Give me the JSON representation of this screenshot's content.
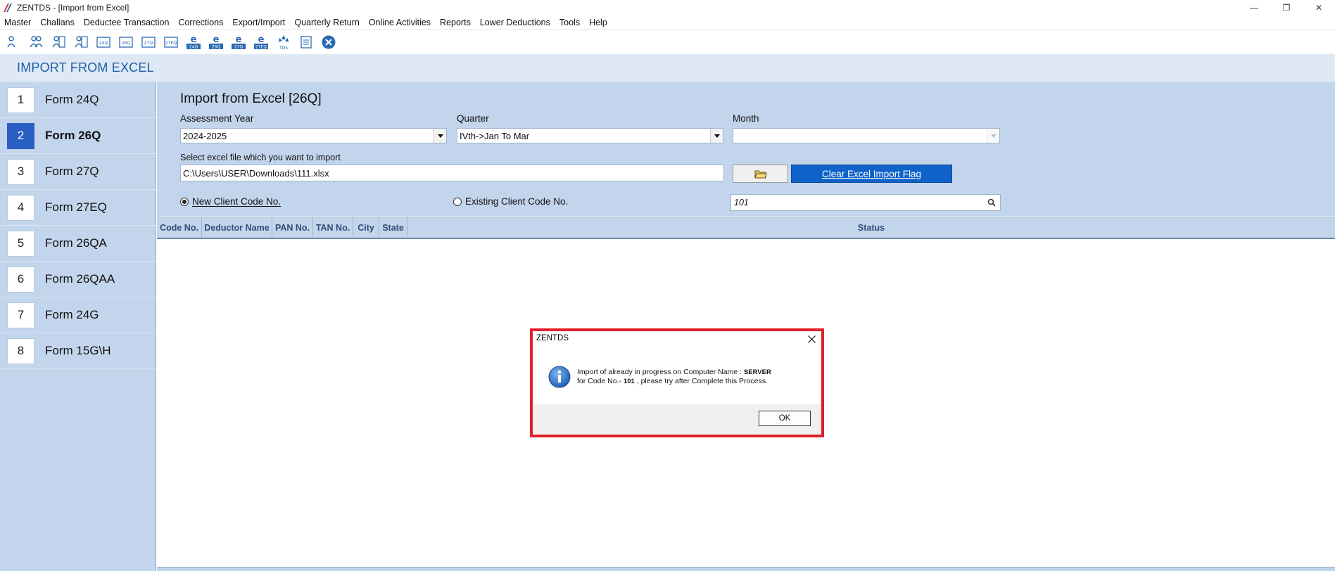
{
  "window": {
    "title": "ZENTDS - [Import from Excel]",
    "minimize_glyph": "—",
    "restore_glyph": "❐",
    "close_glyph": "✕"
  },
  "menu": [
    "Master",
    "Challans",
    "Deductee Transaction",
    "Corrections",
    "Export/Import",
    "Quarterly Return",
    "Online Activities",
    "Reports",
    "Lower Deductions",
    "Tools",
    "Help"
  ],
  "toolbar": {
    "icons": [
      {
        "name": "users-icon"
      },
      {
        "name": "group-icon"
      },
      {
        "name": "person-doc-icon"
      },
      {
        "name": "person-doc2-icon"
      },
      {
        "name": "form-24q-doc-icon",
        "label": "24Q"
      },
      {
        "name": "form-26q-doc-icon",
        "label": "26Q"
      },
      {
        "name": "form-27q-doc-icon",
        "label": "27Q"
      },
      {
        "name": "form-27eq-doc-icon",
        "label": "27EQ"
      },
      {
        "name": "e-24q-icon",
        "label": "24Q"
      },
      {
        "name": "e-26q-icon",
        "label": "26Q"
      },
      {
        "name": "e-27q-icon",
        "label": "27Q"
      },
      {
        "name": "e-27eq-icon",
        "label": "27EQ"
      },
      {
        "name": "tds-icon",
        "label": "TDS"
      },
      {
        "name": "report-doc-icon"
      },
      {
        "name": "exit-icon"
      }
    ],
    "accent": "#2a6ab3"
  },
  "header": {
    "title": "IMPORT FROM EXCEL"
  },
  "sidebar": {
    "items": [
      {
        "num": "1",
        "label": "Form 24Q",
        "active": false
      },
      {
        "num": "2",
        "label": "Form 26Q",
        "active": true
      },
      {
        "num": "3",
        "label": "Form 27Q",
        "active": false
      },
      {
        "num": "4",
        "label": "Form 27EQ",
        "active": false
      },
      {
        "num": "5",
        "label": "Form 26QA",
        "active": false
      },
      {
        "num": "6",
        "label": "Form 26QAA",
        "active": false
      },
      {
        "num": "7",
        "label": "Form 24G",
        "active": false
      },
      {
        "num": "8",
        "label": "Form 15G\\H",
        "active": false
      }
    ]
  },
  "main": {
    "title": "Import from Excel [26Q]",
    "assessment_year_label": "Assessment Year",
    "assessment_year_value": "2024-2025",
    "quarter_label": "Quarter",
    "quarter_value": "IVth->Jan To Mar",
    "month_label": "Month",
    "month_value": "",
    "file_label": "Select excel file which you want to import",
    "file_value": "C:\\Users\\USER\\Downloads\\111.xlsx",
    "clear_button": "Clear Excel Import Flag",
    "radio_new": "New Client Code No.",
    "radio_existing": "Existing Client Code No.",
    "selected_radio": "new",
    "client_code_value": "101"
  },
  "table": {
    "columns": [
      "Code No.",
      "Deductor Name",
      "PAN No.",
      "TAN No.",
      "City",
      "State",
      "Status"
    ]
  },
  "dialog": {
    "title": "ZENTDS",
    "msg_line1_prefix": "Import of  already in progress on Computer Name : ",
    "computer_name": "SERVER",
    "msg_line2_prefix": "for Code No.- ",
    "code_no": "101",
    "msg_line2_suffix": " , please try after Complete this Process.",
    "ok_label": "OK",
    "highlight_color": "#e0202a"
  }
}
